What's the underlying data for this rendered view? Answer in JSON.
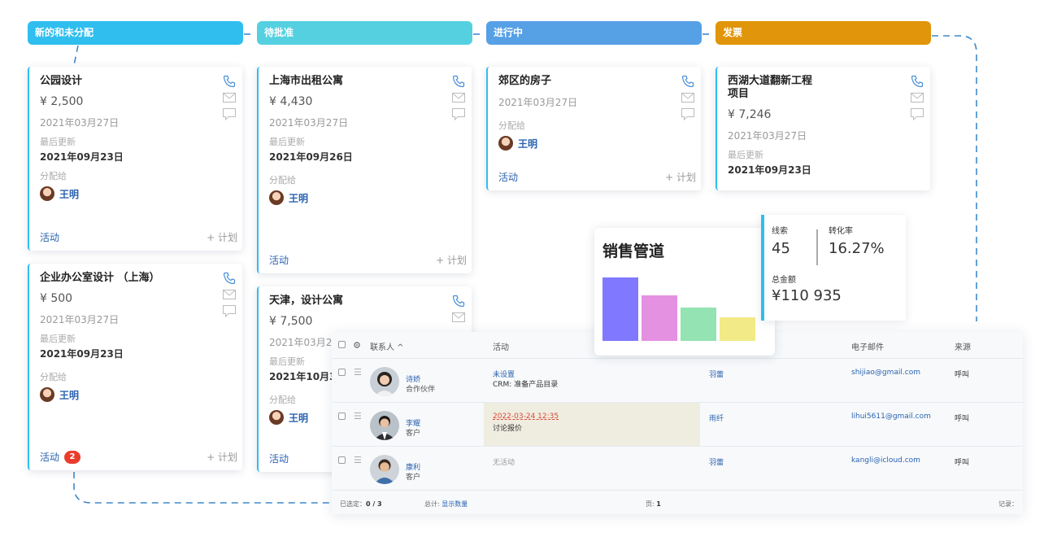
{
  "columns": [
    {
      "title": "新的和未分配"
    },
    {
      "title": "待批准"
    },
    {
      "title": "进行中"
    },
    {
      "title": "发票"
    }
  ],
  "cards": [
    {
      "title": "公园设计",
      "amount": "¥ 2,500",
      "date": "2021年03月27日",
      "updated_label": "最后更新",
      "updated": "2021年09月23日",
      "assign_label": "分配给",
      "assignee": "王明",
      "activity": "活动",
      "plan": "+ 计划"
    },
    {
      "title": "企业办公室设计 （上海）",
      "amount": "¥ 500",
      "date": "2021年03月27日",
      "updated_label": "最后更新",
      "updated": "2021年09月23日",
      "assign_label": "分配给",
      "assignee": "王明",
      "activity": "活动",
      "badge": "2",
      "plan": "+ 计划"
    },
    {
      "title": "上海市出租公寓",
      "amount": "¥ 4,430",
      "date": "2021年03月27日",
      "updated_label": "最后更新",
      "updated": "2021年09月26日",
      "assign_label": "分配给",
      "assignee": "王明",
      "activity": "活动",
      "plan": "+ 计划"
    },
    {
      "title": "天津，设计公寓",
      "amount": "¥ 7,500",
      "date": "2021年03月27日",
      "updated_label": "最后更新",
      "updated": "2021年10月3",
      "assign_label": "分配给",
      "assignee": "王明",
      "activity": "活动"
    },
    {
      "title": "郊区的房子",
      "date": "2021年03月27日",
      "assign_label": "分配给",
      "assignee": "王明",
      "activity": "活动",
      "plan": "+ 计划"
    },
    {
      "title": "西湖大道翻新工程项目",
      "amount": "¥ 7,246",
      "date": "2021年03月27日",
      "updated_label": "最后更新",
      "updated": "2021年09月23日"
    }
  ],
  "pipeline": {
    "title": "销售管道",
    "bars": [
      {
        "value": 1.0,
        "color": "#8079ff"
      },
      {
        "value": 0.72,
        "color": "#e491e2"
      },
      {
        "value": 0.53,
        "color": "#94e3b3"
      },
      {
        "value": 0.37,
        "color": "#f2ea86"
      }
    ]
  },
  "stats": {
    "leads_label": "线索",
    "leads": "45",
    "conversion_label": "转化率",
    "conversion": "16.27%",
    "total_label": "总金额",
    "total": "¥110 935"
  },
  "table": {
    "headers": {
      "contact": "联系人 ^",
      "activity": "活动",
      "email": "电子邮件",
      "source": "来源"
    },
    "rows": [
      {
        "name": "诗娇",
        "role": "合作伙伴",
        "activity_line1": "未设置",
        "activity_line2": "CRM: 准备产品目录",
        "assigned": "羽蕾",
        "email": "shijiao@gmail.com",
        "source": "呼叫"
      },
      {
        "name": "李耀",
        "role": "客户",
        "activity_line1": "2022-03-24 12:35",
        "activity_line2": "讨论报价",
        "assigned": "雨纤",
        "email": "lihui5611@gmail.com",
        "source": "呼叫"
      },
      {
        "name": "康利",
        "role": "客户",
        "activity_line1": "无活动",
        "assigned": "羽蕾",
        "email": "kangli@icloud.com",
        "source": "呼叫"
      }
    ],
    "footer": {
      "selected_label": "已选定：",
      "selected": "0 / 3",
      "total_label": "总计:",
      "total_link": "显示数量",
      "page_label": "页:",
      "page": "1",
      "records_label": "记录："
    }
  }
}
